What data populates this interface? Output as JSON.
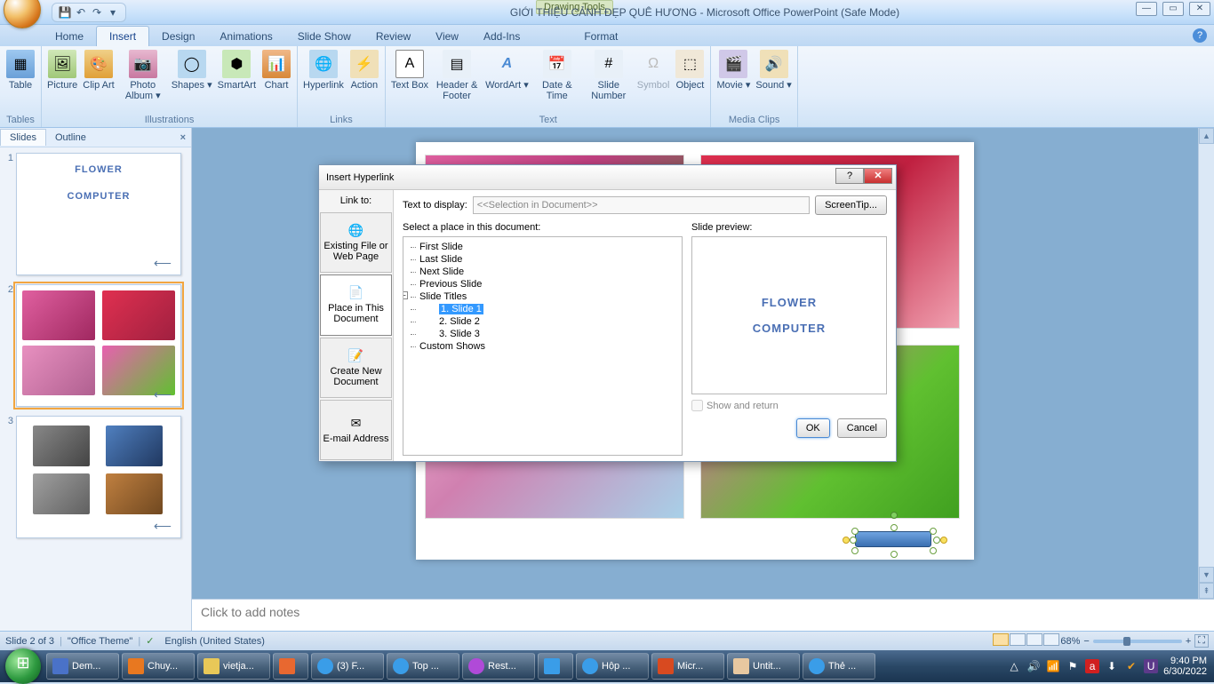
{
  "window": {
    "contextual_tab": "Drawing Tools",
    "document_title": "GIỚI THIỆU CẢNH ĐẸP QUÊ HƯƠNG - Microsoft Office PowerPoint (Safe Mode)",
    "controls": {
      "min": "—",
      "max": "▭",
      "close": "✕"
    }
  },
  "ribbon_tabs": [
    "Home",
    "Insert",
    "Design",
    "Animations",
    "Slide Show",
    "Review",
    "View",
    "Add-Ins"
  ],
  "ribbon_tabs_extra": "Format",
  "ribbon_active": "Insert",
  "ribbon": {
    "tables": {
      "caption": "Tables",
      "items": [
        {
          "label": "Table"
        }
      ]
    },
    "illustrations": {
      "caption": "Illustrations",
      "items": [
        {
          "label": "Picture"
        },
        {
          "label": "Clip\nArt"
        },
        {
          "label": "Photo\nAlbum ▾"
        },
        {
          "label": "Shapes ▾"
        },
        {
          "label": "SmartArt"
        },
        {
          "label": "Chart"
        }
      ]
    },
    "links": {
      "caption": "Links",
      "items": [
        {
          "label": "Hyperlink"
        },
        {
          "label": "Action"
        }
      ]
    },
    "text": {
      "caption": "Text",
      "items": [
        {
          "label": "Text\nBox"
        },
        {
          "label": "Header\n& Footer"
        },
        {
          "label": "WordArt ▾"
        },
        {
          "label": "Date\n& Time"
        },
        {
          "label": "Slide\nNumber"
        },
        {
          "label": "Symbol",
          "disabled": true
        },
        {
          "label": "Object"
        }
      ]
    },
    "media": {
      "caption": "Media Clips",
      "items": [
        {
          "label": "Movie ▾"
        },
        {
          "label": "Sound ▾"
        }
      ]
    }
  },
  "pane_tabs": {
    "slides": "Slides",
    "outline": "Outline"
  },
  "thumbs": {
    "slide1": {
      "text1": "FLOWER",
      "text2": "COMPUTER"
    }
  },
  "notes_placeholder": "Click to add notes",
  "statusbar": {
    "slide_info": "Slide 2 of 3",
    "theme": "\"Office Theme\"",
    "language": "English (United States)",
    "zoom": "68%"
  },
  "dialog": {
    "title": "Insert Hyperlink",
    "linkto_label": "Link to:",
    "text_to_display": "Text to display:",
    "text_to_display_value": "<<Selection in Document>>",
    "screentip": "ScreenTip...",
    "linkto_items": [
      {
        "label": "Existing File or\nWeb Page",
        "active": false
      },
      {
        "label": "Place in This\nDocument",
        "active": true
      },
      {
        "label": "Create New\nDocument",
        "active": false
      },
      {
        "label": "E-mail Address",
        "active": false
      }
    ],
    "select_place": "Select a place in this document:",
    "tree": {
      "first": "First Slide",
      "last": "Last Slide",
      "next": "Next Slide",
      "prev": "Previous Slide",
      "titles": "Slide Titles",
      "s1": "1. Slide 1",
      "s2": "2. Slide 2",
      "s3": "3. Slide 3",
      "custom": "Custom Shows"
    },
    "preview_label": "Slide preview:",
    "preview": {
      "t1": "FLOWER",
      "t2": "COMPUTER"
    },
    "show_return": "Show and return",
    "ok": "OK",
    "cancel": "Cancel"
  },
  "taskbar": {
    "items": [
      {
        "label": "Dem...",
        "color": "#4a72c8"
      },
      {
        "label": "Chuy...",
        "color": "#e87820"
      },
      {
        "label": "vietja...",
        "color": "#e8c858"
      },
      {
        "label": "",
        "color": "#e86830"
      },
      {
        "label": "(3) F...",
        "color": "#3a9de8"
      },
      {
        "label": "Top ...",
        "color": "#3a9de8"
      },
      {
        "label": "Rest...",
        "color": "#b04ad8"
      },
      {
        "label": "",
        "color": "#3a9de8"
      },
      {
        "label": "Hộp ...",
        "color": "#3a9de8"
      },
      {
        "label": "Micr...",
        "color": "#d84a20"
      },
      {
        "label": "Untit...",
        "color": "#e8c8a0"
      },
      {
        "label": "Thẻ ...",
        "color": "#3a9de8"
      }
    ],
    "time": "9:40 PM",
    "date": "6/30/2022"
  }
}
